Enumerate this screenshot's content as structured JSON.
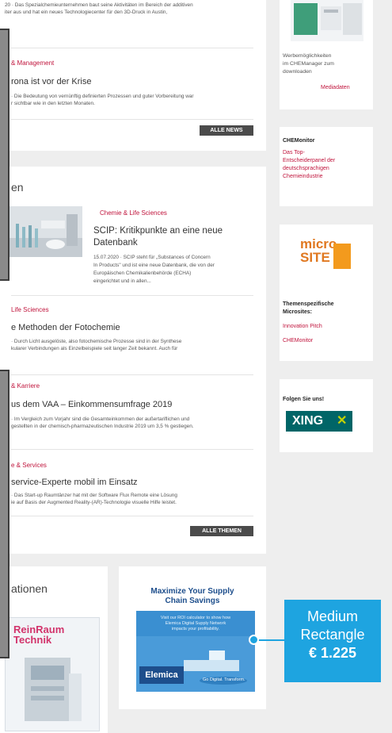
{
  "news": {
    "item1_text_line1": "20 · Das Spezialchemieunternehmen baut seine Aktivitäten im Bereich der additiven",
    "item1_text_line2": "iter aus und hat ein neues Technologiecenter für den 3D-Druck in Austin,",
    "item2_category": "& Management",
    "item2_title": "rona ist vor der Krise",
    "item2_text_line1": "· Die Bedeutung von vernünftig definierten Prozessen und guter Vorbereitung war",
    "item2_text_line2": "r sichtbar wie in den letzten Monaten.",
    "all_news_label": "ALLE NEWS"
  },
  "topics": {
    "section_title": "en",
    "feature_category": "Chemie & Life Sciences",
    "feature_title_line1": "SCIP: Kritikpunkte an eine neue",
    "feature_title_line2": "Datenbank",
    "feature_text_line1": "15.07.2020 · SCIP steht für „Substances of Concern",
    "feature_text_line2": "In Products\" und ist eine neue Datenbank, die von der",
    "feature_text_line3": "Europäischen Chemikalienbehörde (ECHA)",
    "feature_text_line4": "eingerichtet und in allen...",
    "item2_category": "Life Sciences",
    "item2_title": "e Methoden der Fotochemie",
    "item2_text_line1": "· Durch Licht ausgelöste, also fotochemische Prozesse sind in der Synthese",
    "item2_text_line2": "kularer Verbindungen als Einzelbeispiele seit langer Zeit bekannt. Auch für",
    "item3_category": "& Karriere",
    "item3_title": "us dem VAA – Einkommensumfrage 2019",
    "item3_text_line1": "· Im Vergleich zum Vorjahr sind die Gesamteinkommen der außertariflichen und",
    "item3_text_line2": "gestellten in der chemisch-pharmazeutischen Industrie 2019 um 3,5 % gestiegen.",
    "item4_category": "e & Services",
    "item4_title": "service-Experte mobil im Einsatz",
    "item4_text_line1": "· Das Start-up Raumtänzer hat mit der Software Flux Remote eine Lösung",
    "item4_text_line2": "ie auf Basis der Augmented Reality-(AR)-Technologie visuelle Hilfe leistet.",
    "all_topics_label": "ALLE THEMEN"
  },
  "publications": {
    "section_title": "ationen",
    "magazine_title_line1": "ReinRaum",
    "magazine_title_line2": "Technik"
  },
  "ad": {
    "headline_line1": "Maximize Your Supply",
    "headline_line2": "Chain Savings",
    "subtext_line1": "Visit our ROI calculator to show how",
    "subtext_line2": "Elemica Digital Supply Network",
    "subtext_line3": "impacts your profitability.",
    "logo_text": "Elemica",
    "tagline": "Go Digital. Transform."
  },
  "sidebar": {
    "media_text_line1": "Werbemöglichkeiten",
    "media_text_line2": "im CHEManager zum",
    "media_text_line3": "downloaden",
    "media_link": "Mediadaten",
    "chemonitor_label": "CHEMonitor",
    "chemonitor_link_line1": "Das Top-",
    "chemonitor_link_line2": "Entscheiderpanel der",
    "chemonitor_link_line3": "deutschsprachigen",
    "chemonitor_link_line4": "Chemieindustrie",
    "micro_logo_line1": "micro",
    "micro_logo_line2": "SITE",
    "micro_label_line1": "Themenspezifische",
    "micro_label_line2": "Microsites:",
    "micro_link1": "Innovation Pitch",
    "micro_link2": "CHEMonitor",
    "follow_label": "Folgen Sie uns!",
    "xing_label": "XING"
  },
  "price_tag": {
    "line1": "Medium",
    "line2": "Rectangle",
    "price": "€ 1.225"
  },
  "colors": {
    "accent_red": "#c0143c",
    "tag_blue": "#1ea4e0",
    "xing_green": "#c6d300",
    "xing_teal": "#006567"
  }
}
